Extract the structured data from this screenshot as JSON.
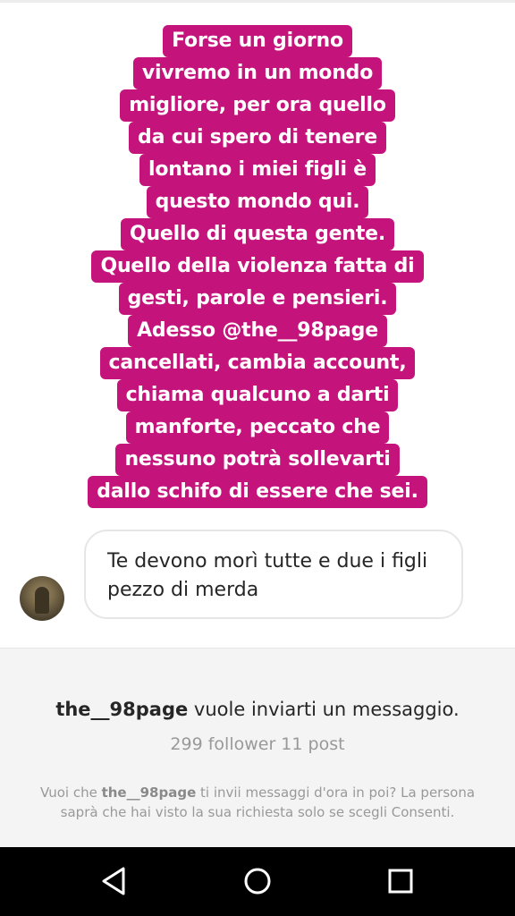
{
  "story": {
    "lines": [
      "Forse un giorno",
      "vivremo in un mondo",
      "migliore, per ora quello",
      "da cui spero di tenere",
      "lontano i miei figli è",
      "questo mondo qui.",
      "Quello di questa gente.",
      "Quello della violenza fatta di",
      "gesti, parole e pensieri.",
      "Adesso @the__98page",
      "cancellati, cambia account,",
      "chiama qualcuno a darti",
      "manforte, peccato che",
      "nessuno potrà sollevarti",
      "dallo schifo di essere che sei."
    ],
    "highlight_color": "#c4137a"
  },
  "message": {
    "text": "Te devono morì tutte e due i figli pezzo di merda"
  },
  "request": {
    "username": "the__98page",
    "title_suffix": " vuole inviarti un messaggio.",
    "stats": "299 follower 11 post",
    "note_prefix": "Vuoi che ",
    "note_username": "the__98page",
    "note_suffix": " ti invii messaggi d'ora in poi? La persona saprà che hai visto la sua richiesta solo se scegli Consenti."
  },
  "navbar": {
    "back_icon": "triangle-back-icon",
    "home_icon": "circle-home-icon",
    "recent_icon": "square-recents-icon"
  }
}
